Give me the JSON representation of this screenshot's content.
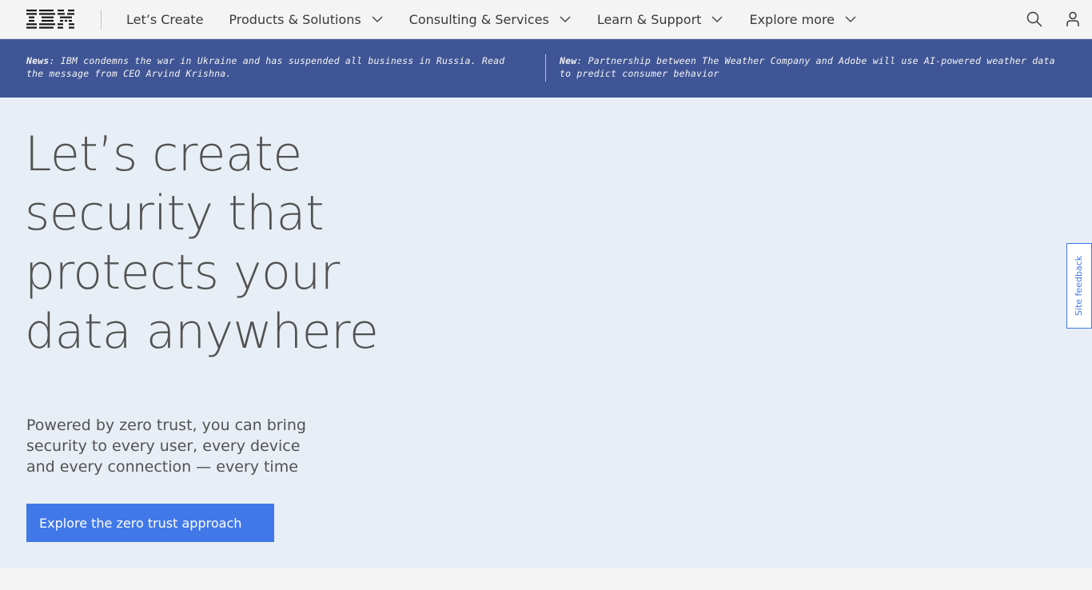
{
  "header": {
    "logo_text": "IBM",
    "nav": [
      {
        "label": "Let’s Create",
        "has_dropdown": false
      },
      {
        "label": "Products & Solutions",
        "has_dropdown": true
      },
      {
        "label": "Consulting & Services",
        "has_dropdown": true
      },
      {
        "label": "Learn & Support",
        "has_dropdown": true
      },
      {
        "label": "Explore more",
        "has_dropdown": true
      }
    ],
    "icons": [
      "search-icon",
      "user-icon"
    ]
  },
  "banner": {
    "left": {
      "tag": "News",
      "text": ": IBM condemns the war in Ukraine and has suspended all business in Russia. Read the message from CEO Arvind Krishna."
    },
    "right": {
      "tag": "New",
      "text": ": Partnership between The Weather Company and Adobe will use AI-powered weather data to predict consumer behavior"
    }
  },
  "hero": {
    "title": "Let’s create security that protects your data anywhere",
    "subtitle": "Powered by zero trust, you can bring security to every user, every device and every connection — every time",
    "cta_label": "Explore the zero trust approach"
  },
  "feedback_label": "Site feedback",
  "colors": {
    "banner_bg": "#3f5595",
    "hero_bg": "#e8eef5",
    "cta_bg": "#4178e8",
    "text_muted": "#525252"
  }
}
